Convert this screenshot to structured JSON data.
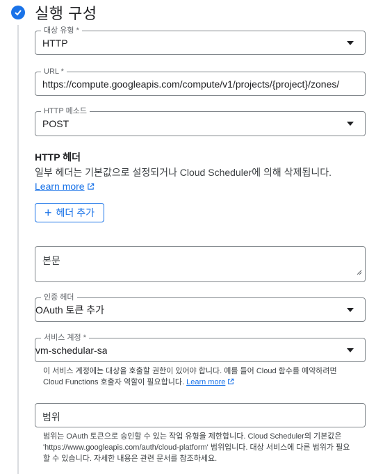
{
  "section": {
    "title": "실행 구성"
  },
  "target_type": {
    "label": "대상 유형 *",
    "value": "HTTP"
  },
  "url": {
    "label": "URL *",
    "value": "https://compute.googleapis.com/compute/v1/projects/{project}/zones/"
  },
  "http_method": {
    "label": "HTTP 메소드",
    "value": "POST"
  },
  "http_headers": {
    "title": "HTTP 헤더",
    "description": "일부 헤더는 기본값으로 설정되거나 Cloud Scheduler에 의해 삭제됩니다.",
    "learn_more": "Learn more",
    "add_button": "헤더 추가"
  },
  "body": {
    "placeholder": "본문"
  },
  "auth_header": {
    "label": "인증 헤더",
    "value": "OAuth 토큰 추가"
  },
  "service_account": {
    "label": "서비스 계정 *",
    "value": "vm-schedular-sa",
    "hint": "이 서비스 계정에는 대상을 호출할 권한이 있어야 합니다. 예를 들어 Cloud 함수를 예약하려면 Cloud Functions 호출자 역할이 필요합니다.",
    "learn_more": "Learn more"
  },
  "scope": {
    "placeholder": "범위",
    "hint": "범위는 OAuth 토큰으로 승인할 수 있는 작업 유형을 제한합니다. Cloud Scheduler의 기본값은 'https://www.googleapis.com/auth/cloud-platform' 범위입니다. 대상 서비스에 다른 범위가 필요할 수 있습니다. 자세한 내용은 관련 문서를 참조하세요."
  },
  "colors": {
    "accent": "#1a73e8",
    "border": "#80868b",
    "text": "#202124",
    "muted": "#5f6368"
  },
  "icons": [
    "check-circle-icon",
    "dropdown-caret-icon",
    "external-link-icon",
    "plus-icon",
    "resize-handle-icon"
  ]
}
